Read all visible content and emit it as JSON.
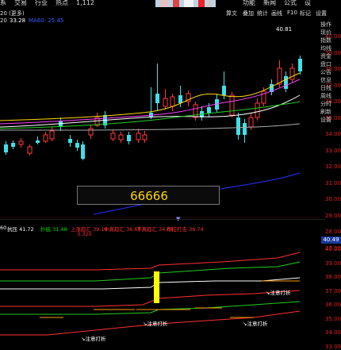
{
  "menubar": {
    "items": [
      "系",
      "交易",
      "行业",
      "热点",
      "1,112"
    ],
    "right_items": [
      "功能",
      "新闻",
      "公式",
      "设"
    ]
  },
  "toolbar": {
    "left_items": [
      "20 (更多)"
    ],
    "right_items": [
      "算文",
      "叠加",
      "统计",
      "画线",
      "F10",
      "标记",
      "设置"
    ]
  },
  "infobar": {
    "time": "20",
    "price": "33.28",
    "ma_text": "MA60: 25.45"
  },
  "price_axis": [
    "40.00",
    "39.00",
    "38.00",
    "37.00",
    "36.00",
    "35.00",
    "34.00",
    "33.00",
    "32.00",
    "31.00",
    "30.00",
    "29.00",
    "28.00",
    "27.00"
  ],
  "right_panel": [
    "操作",
    "现价",
    "指数",
    "均线",
    "资金",
    "盘口",
    "公告",
    "信息",
    "日线",
    "周线",
    "分时",
    "刷新",
    "设置"
  ],
  "high_label": "40.81",
  "popup_value": "66666",
  "indicator": {
    "header": [
      {
        "text": "60",
        "color": "#ffffff"
      },
      {
        "text": "抗压 41.72",
        "color": "#ffffff"
      },
      {
        "text": "扑底 31.48",
        "color": "#00e000"
      },
      {
        "text": "上涨趋汇 39.15",
        "color": "#ff3030"
      },
      {
        "text": "中真趋汇 36.60",
        "color": "#ff3030"
      },
      {
        "text": "下真趋汇 34.08",
        "color": "#ff3030"
      },
      {
        "text": "布控打击 36.74",
        "color": "#ff3030"
      }
    ],
    "subline": "3.320",
    "level_box": "40.49",
    "axis": [
      "40.00",
      "39.00",
      "38.00",
      "37.00",
      "36.00",
      "35.00",
      "34.00",
      "33.00"
    ],
    "notes": [
      "注意打析",
      "注意打析",
      "注意打析",
      "注意打析"
    ]
  }
}
